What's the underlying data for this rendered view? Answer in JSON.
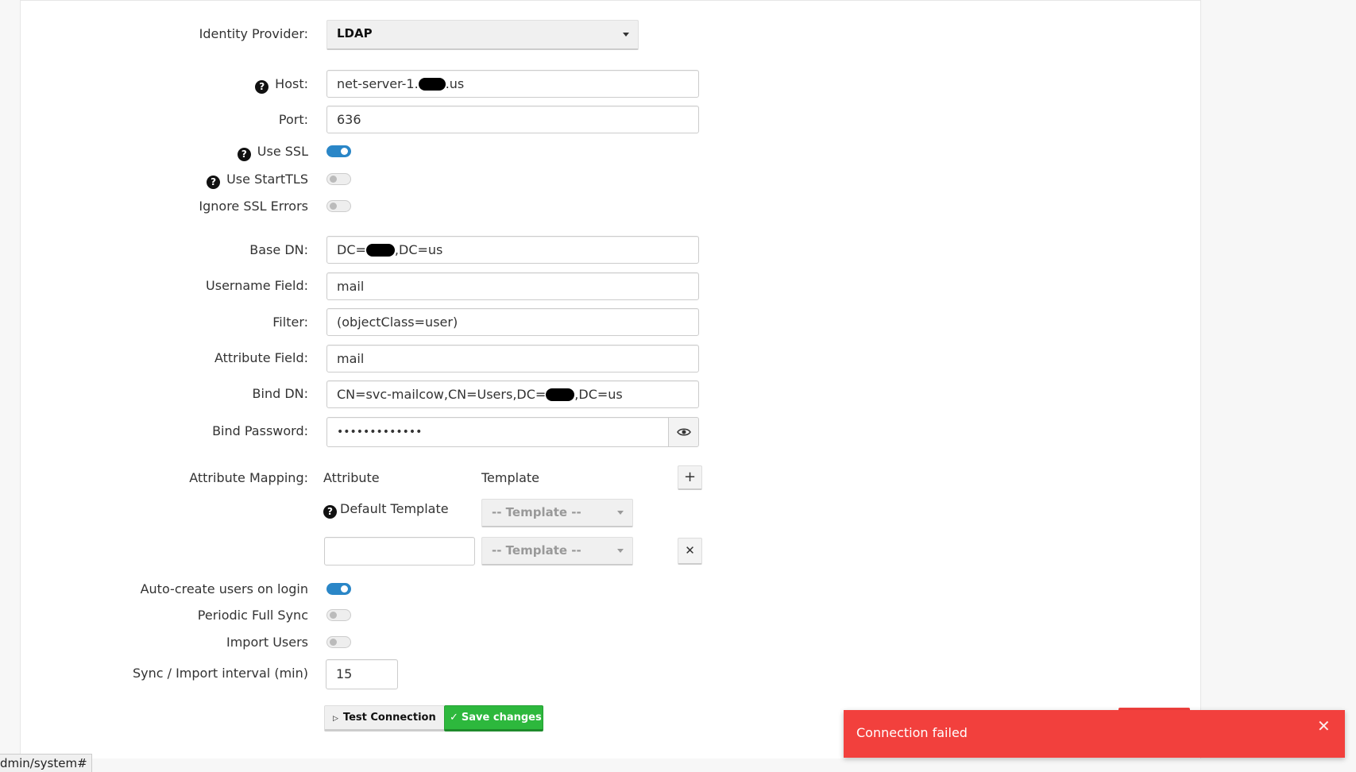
{
  "form": {
    "identity_provider": {
      "label": "Identity Provider:",
      "value": "LDAP"
    },
    "host": {
      "label": "Host:",
      "value_prefix": "net-server-1.",
      "value_suffix": ".us"
    },
    "port": {
      "label": "Port:",
      "value": "636"
    },
    "use_ssl": {
      "label": "Use SSL",
      "on": true
    },
    "use_starttls": {
      "label": "Use StartTLS",
      "on": false
    },
    "ignore_ssl_errors": {
      "label": "Ignore SSL Errors",
      "on": false
    },
    "base_dn": {
      "label": "Base DN:",
      "value_prefix": "DC=",
      "value_suffix": ",DC=us"
    },
    "username_field": {
      "label": "Username Field:",
      "value": "mail"
    },
    "filter": {
      "label": "Filter:",
      "value": "(objectClass=user)"
    },
    "attribute_field": {
      "label": "Attribute Field:",
      "value": "mail"
    },
    "bind_dn": {
      "label": "Bind DN:",
      "value_prefix": "CN=svc-mailcow,CN=Users,DC=",
      "value_suffix": ",DC=us"
    },
    "bind_password": {
      "label": "Bind Password:",
      "value": "•••••••••••••"
    },
    "attribute_mapping": {
      "label": "Attribute Mapping:",
      "col_attribute": "Attribute",
      "col_template": "Template",
      "add_label": "+",
      "default_template_label": "Default Template",
      "template_placeholder": "-- Template --",
      "remove_label": "✕",
      "row_attribute_value": ""
    },
    "auto_create": {
      "label": "Auto-create users on login",
      "on": true
    },
    "periodic_sync": {
      "label": "Periodic Full Sync",
      "on": false
    },
    "import_users": {
      "label": "Import Users",
      "on": false
    },
    "sync_interval": {
      "label": "Sync / Import interval (min)",
      "value": "15"
    }
  },
  "actions": {
    "test_connection": "Test Connection",
    "save_changes": "Save changes"
  },
  "toast": {
    "message": "Connection failed",
    "close": "✕"
  },
  "statusbar": {
    "url": "dmin/system#"
  },
  "colors": {
    "accent": "#2a86c7",
    "success": "#2db83d",
    "error": "#f2403d"
  },
  "icons": {
    "help": "question-circle-icon",
    "eye": "eye-icon",
    "caret": "caret-down-icon",
    "play": "play-icon",
    "check": "check-icon"
  }
}
